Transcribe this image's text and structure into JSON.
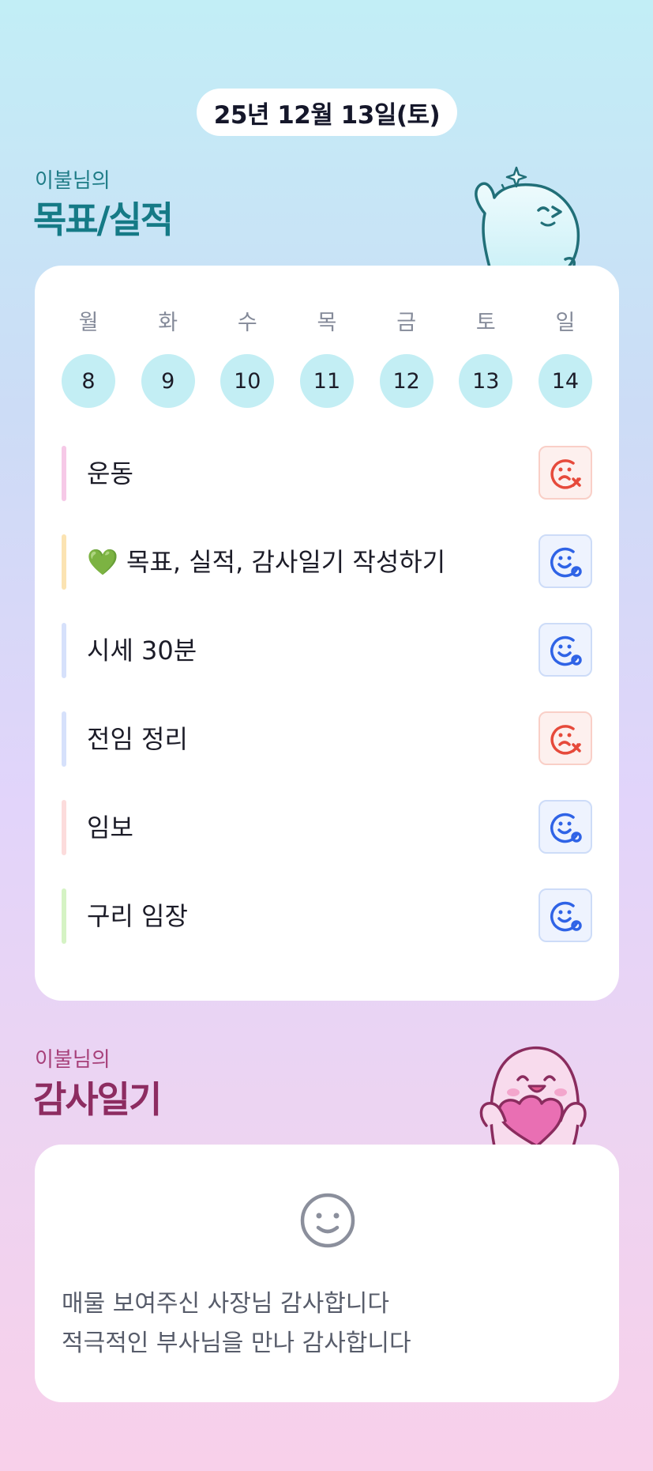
{
  "header": {
    "date": "25년 12월 13일(토)"
  },
  "goals_section": {
    "subtitle": "이불님의",
    "title": "목표/실적"
  },
  "week": {
    "weekdays": [
      "월",
      "화",
      "수",
      "목",
      "금",
      "토",
      "일"
    ],
    "days": [
      "8",
      "9",
      "10",
      "11",
      "12",
      "13",
      "14"
    ]
  },
  "goals": [
    {
      "label": "운동",
      "status": "fail",
      "bar_color": "#f6c9e7"
    },
    {
      "label": "💚 목표, 실적, 감사일기 작성하기",
      "status": "done",
      "bar_color": "#fbe3b2"
    },
    {
      "label": "시세 30분",
      "status": "done",
      "bar_color": "#d6e1fb"
    },
    {
      "label": "전임 정리",
      "status": "fail",
      "bar_color": "#d6e1fb"
    },
    {
      "label": "임보",
      "status": "done",
      "bar_color": "#fcdcdc"
    },
    {
      "label": "구리 임장",
      "status": "done",
      "bar_color": "#d5f3c4"
    }
  ],
  "status_icons": {
    "fail": "sad-face-x-icon",
    "done": "smile-face-check-icon"
  },
  "thanks_section": {
    "subtitle": "이불님의",
    "title": "감사일기",
    "icon": "smile-face-icon",
    "lines": [
      "매물 보여주신 사장님 감사합니다",
      "적극적인 부사님을 만나 감사합니다"
    ]
  },
  "colors": {
    "goal_title": "#157a86",
    "thanks_title": "#8d2c61",
    "day_circle": "#c3eef4",
    "fail": "#e64a3b",
    "done": "#2f63e6"
  }
}
